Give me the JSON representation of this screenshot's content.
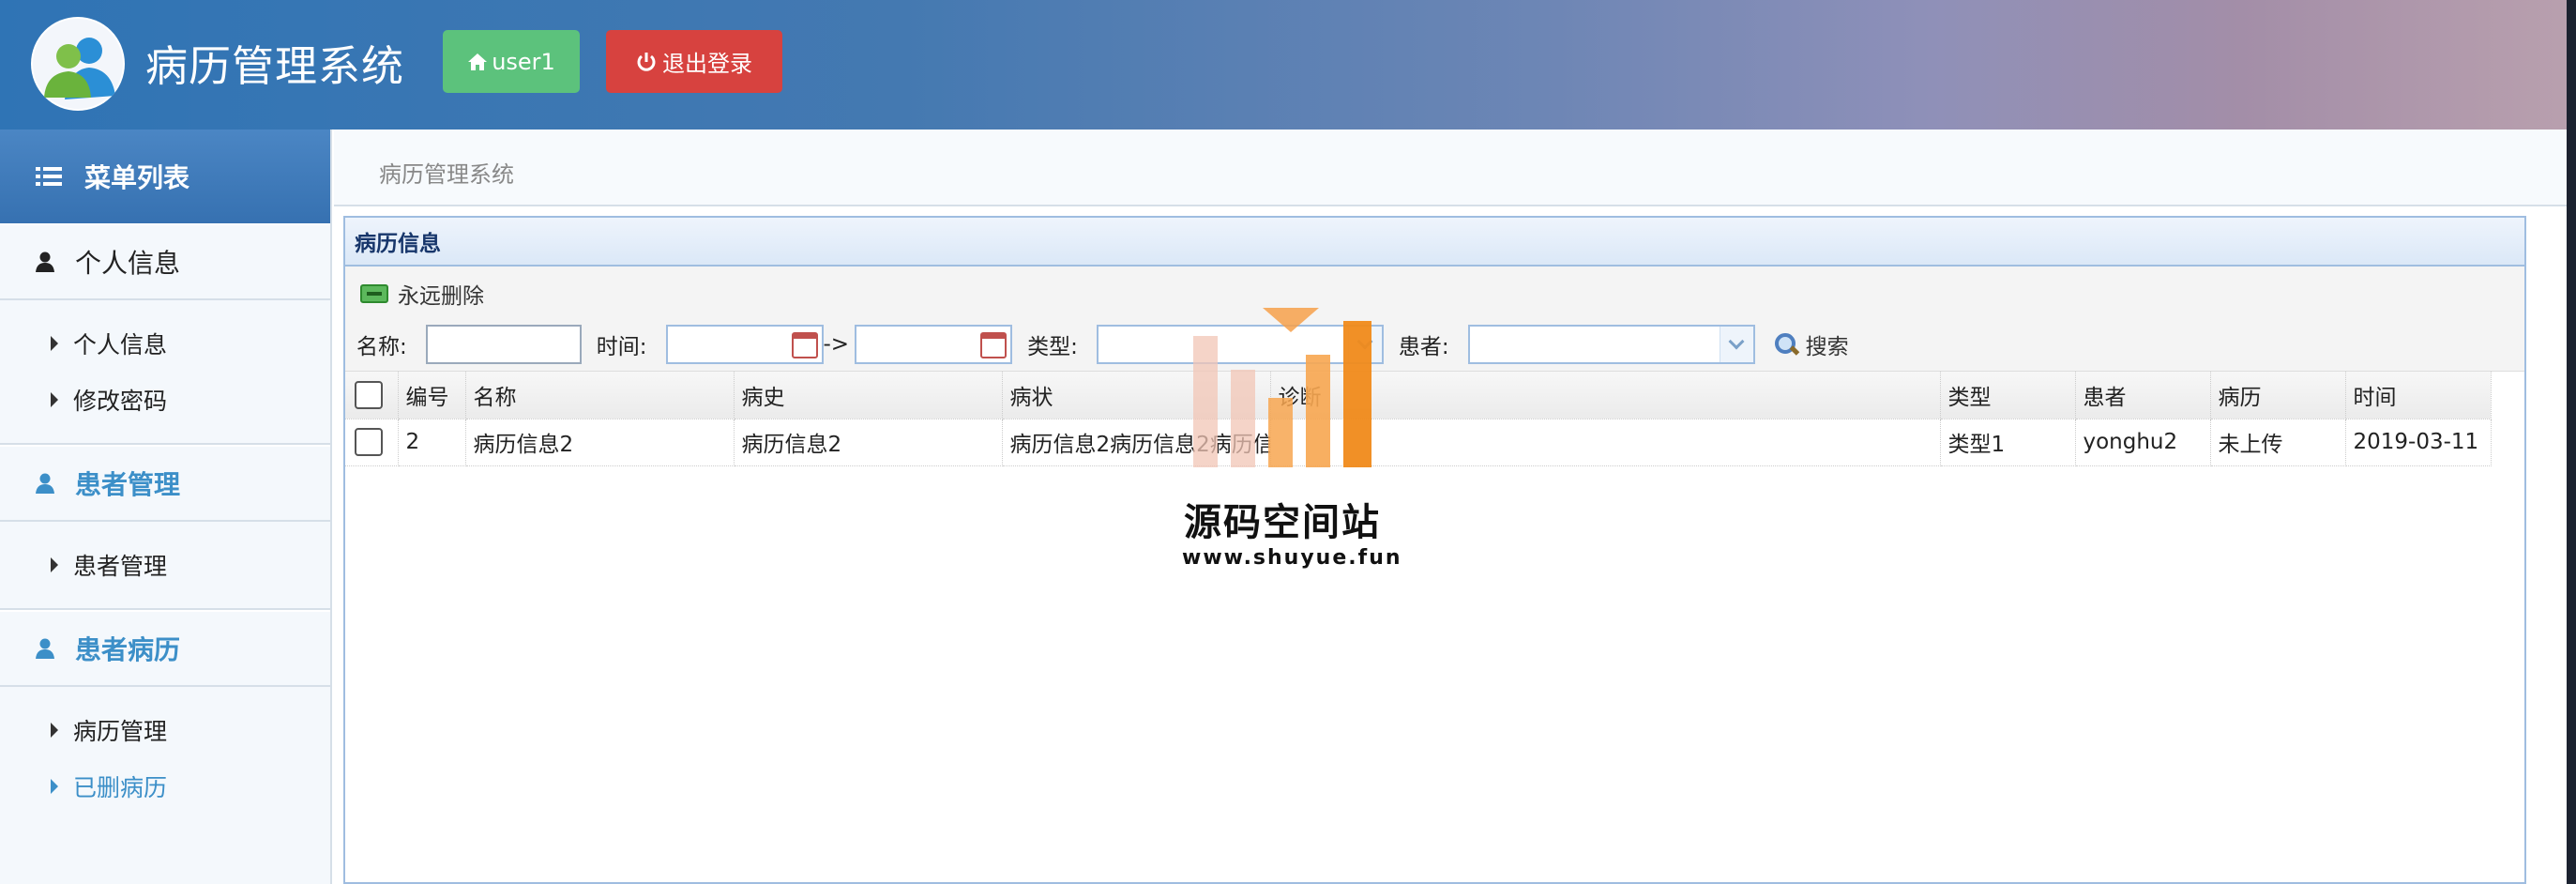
{
  "header": {
    "app_title": "病历管理系统",
    "user_button": "user1",
    "logout_button": "退出登录",
    "user_icon": "home-icon",
    "logout_icon": "power-icon"
  },
  "sidebar": {
    "menu_title": "菜单列表",
    "groups": [
      {
        "label": "个人信息",
        "items": [
          "个人信息",
          "修改密码"
        ]
      },
      {
        "label": "患者管理",
        "items": [
          "患者管理"
        ]
      },
      {
        "label": "患者病历",
        "items": [
          "病历管理",
          "已删病历"
        ]
      }
    ]
  },
  "breadcrumb": "病历管理系统",
  "panel": {
    "title": "病历信息",
    "delete_label": "永远删除",
    "search": {
      "name_label": "名称:",
      "time_label": "时间:",
      "range_sep": "->",
      "type_label": "类型:",
      "patient_label": "患者:",
      "search_label": "搜索"
    }
  },
  "table": {
    "columns": [
      "编号",
      "名称",
      "病史",
      "病状",
      "诊断",
      "类型",
      "患者",
      "病历",
      "时间"
    ],
    "rows": [
      [
        "2",
        "病历信息2",
        "病历信息2",
        "病历信息2病历信息2病历信息2",
        "",
        "类型1",
        "yonghu2",
        "未上传",
        "2019-03-11"
      ]
    ]
  },
  "watermark": {
    "title": "源码空间站",
    "url": "www.shuyue.fun"
  },
  "colors": {
    "accent_blue": "#3c8fc8",
    "user_button": "#5cc27c",
    "logout_button": "#d7423f"
  }
}
